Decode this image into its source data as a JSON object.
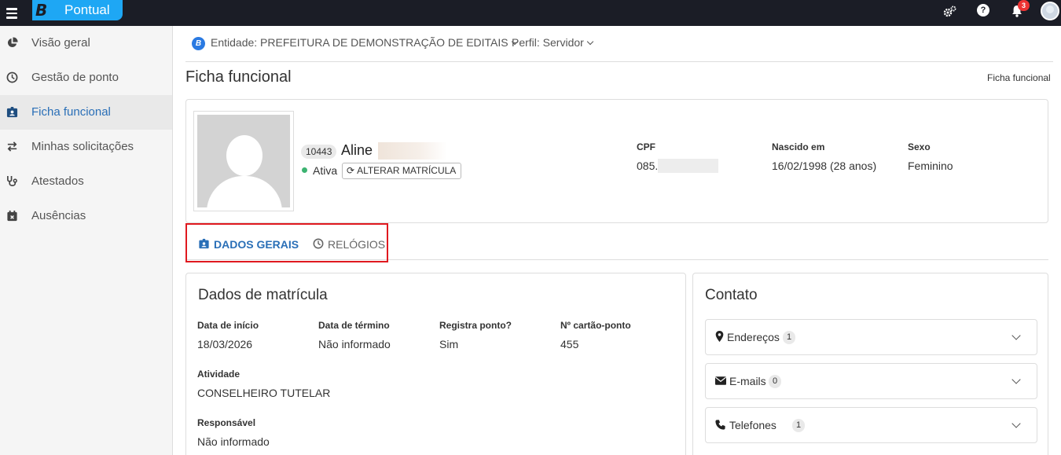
{
  "app": {
    "logo_mark": "B",
    "name": "Pontual",
    "notification_count": "3",
    "help_label": "?"
  },
  "sidebar": {
    "items": [
      {
        "label": "Visão geral",
        "icon": "chart-pie-icon"
      },
      {
        "label": "Gestão de ponto",
        "icon": "clock-icon"
      },
      {
        "label": "Ficha funcional",
        "icon": "id-badge-icon",
        "active": true
      },
      {
        "label": "Minhas solicitações",
        "icon": "exchange-icon"
      },
      {
        "label": "Atestados",
        "icon": "stethoscope-icon"
      },
      {
        "label": "Ausências",
        "icon": "calendar-x-icon"
      }
    ]
  },
  "context": {
    "entity_icon": "B",
    "entity": "Entidade: PREFEITURA DE DEMONSTRAÇÃO DE EDITAIS",
    "perfil": "Perfil: Servidor"
  },
  "page": {
    "title": "Ficha funcional",
    "breadcrumb": "Ficha funcional"
  },
  "employee": {
    "matricula": "10443",
    "name": "Aline",
    "status": "Ativa",
    "alterar_label": "ALTERAR MATRÍCULA",
    "cpf_label": "CPF",
    "cpf": "085.",
    "nascido_label": "Nascido em",
    "nascido": "16/02/1998 (28 anos)",
    "sexo_label": "Sexo",
    "sexo": "Feminino"
  },
  "tabs": [
    {
      "label": "DADOS GERAIS",
      "active": true
    },
    {
      "label": "RELÓGIOS",
      "active": false
    }
  ],
  "matricula": {
    "title": "Dados de matrícula",
    "fields": [
      {
        "label": "Data de início",
        "value": "18/03/2026"
      },
      {
        "label": "Data de término",
        "value": "Não informado"
      },
      {
        "label": "Registra ponto?",
        "value": "Sim"
      },
      {
        "label": "Nº cartão-ponto",
        "value": "455"
      }
    ],
    "atividade_label": "Atividade",
    "atividade": "CONSELHEIRO TUTELAR",
    "responsavel_label": "Responsável",
    "responsavel": "Não informado"
  },
  "contato": {
    "title": "Contato",
    "items": [
      {
        "label": "Endereços",
        "count": "1",
        "icon": "map-marker-icon"
      },
      {
        "label": "E-mails",
        "count": "0",
        "icon": "envelope-icon"
      },
      {
        "label": "Telefones",
        "count": "1",
        "icon": "phone-icon"
      }
    ]
  }
}
